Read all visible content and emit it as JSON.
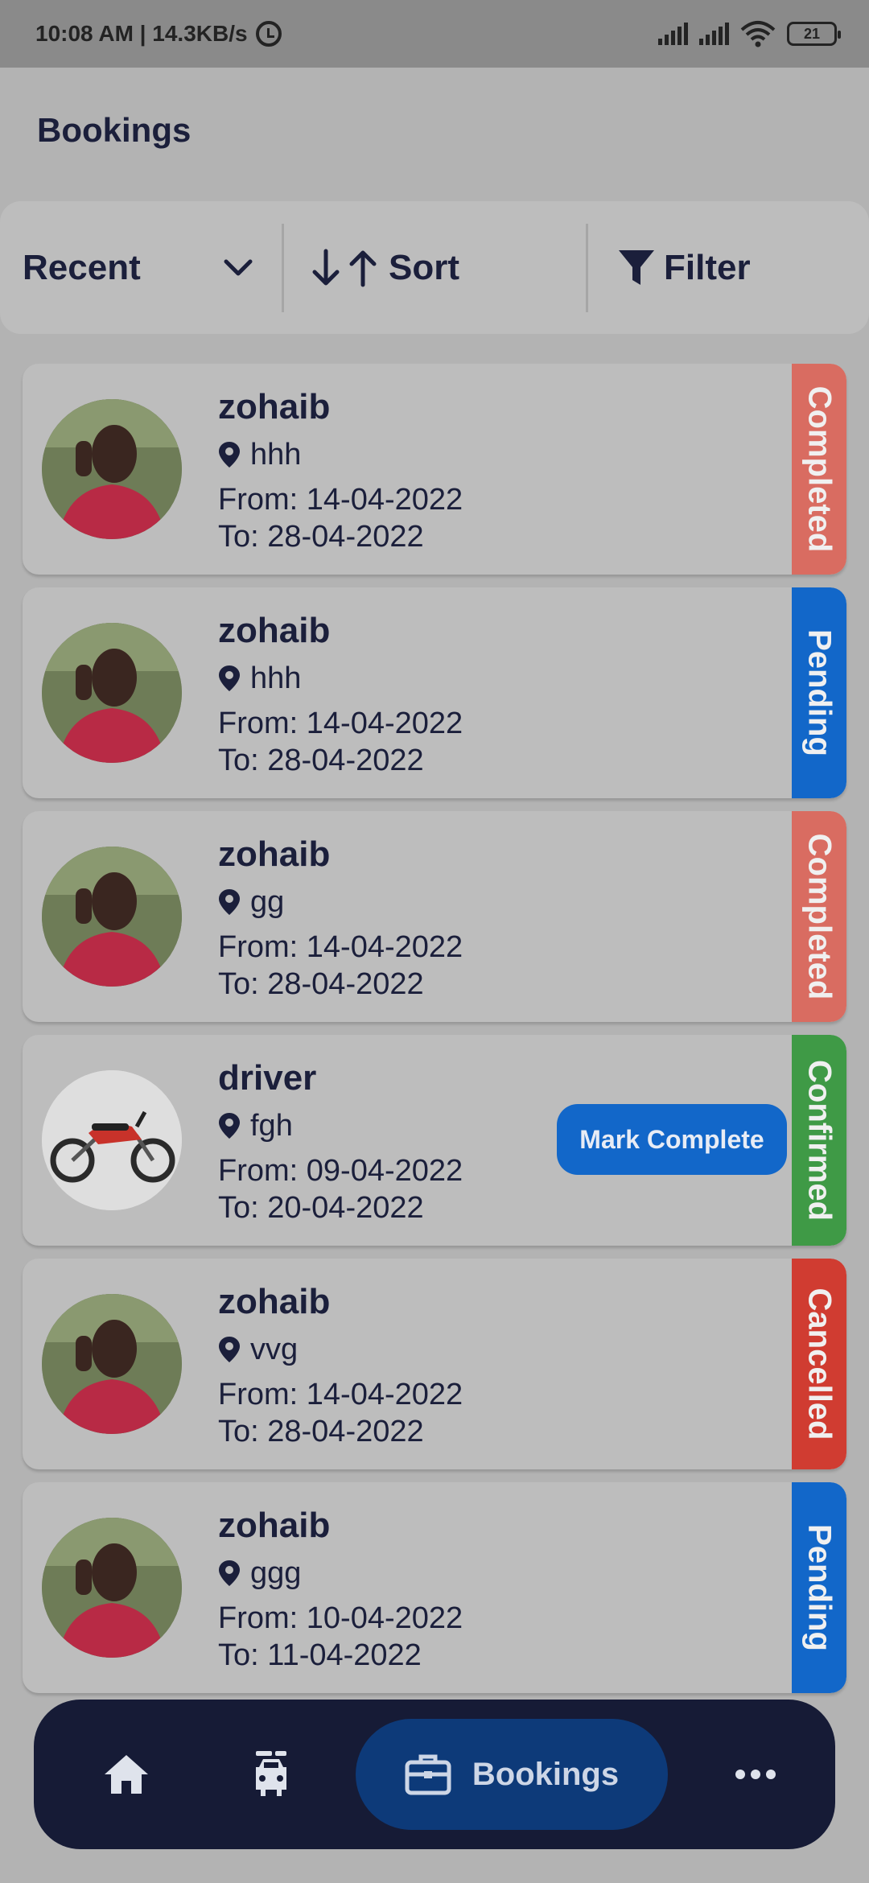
{
  "status_bar": {
    "left_text": "10:08 AM | 14.3KB/s",
    "battery": "21"
  },
  "header": {
    "title": "Bookings"
  },
  "controls": {
    "recent_label": "Recent",
    "sort_label": "Sort",
    "filter_label": "Filter"
  },
  "bookings": [
    {
      "name": "zohaib",
      "location": "hhh",
      "from": "From:  14-04-2022",
      "to": "To: 28-04-2022",
      "status": "Completed",
      "status_color": "#d96c61",
      "avatar": "person"
    },
    {
      "name": "zohaib",
      "location": "hhh",
      "from": "From:  14-04-2022",
      "to": "To: 28-04-2022",
      "status": "Pending",
      "status_color": "#1267c9",
      "avatar": "person"
    },
    {
      "name": "zohaib",
      "location": "gg",
      "from": "From:  14-04-2022",
      "to": "To: 28-04-2022",
      "status": "Completed",
      "status_color": "#d96c61",
      "avatar": "person"
    },
    {
      "name": "driver",
      "location": "fgh",
      "from": "From:  09-04-2022",
      "to": "To: 20-04-2022",
      "status": "Confirmed",
      "status_color": "#3f9a46",
      "avatar": "motorbike",
      "action": "Mark Complete"
    },
    {
      "name": "zohaib",
      "location": "vvg",
      "from": "From:  14-04-2022",
      "to": "To: 28-04-2022",
      "status": "Cancelled",
      "status_color": "#d03c31",
      "avatar": "person"
    },
    {
      "name": "zohaib",
      "location": "ggg",
      "from": "From:  10-04-2022",
      "to": "To: 11-04-2022",
      "status": "Pending",
      "status_color": "#1267c9",
      "avatar": "person"
    }
  ],
  "bottom_nav": {
    "items": [
      {
        "icon": "home-icon"
      },
      {
        "icon": "car-icon"
      },
      {
        "icon": "briefcase-icon",
        "label": "Bookings",
        "active": true
      },
      {
        "icon": "more-icon"
      }
    ]
  },
  "colors": {
    "primary": "#1267c9",
    "nav_background": "#161b36",
    "text_dark": "#1b1f3b"
  }
}
